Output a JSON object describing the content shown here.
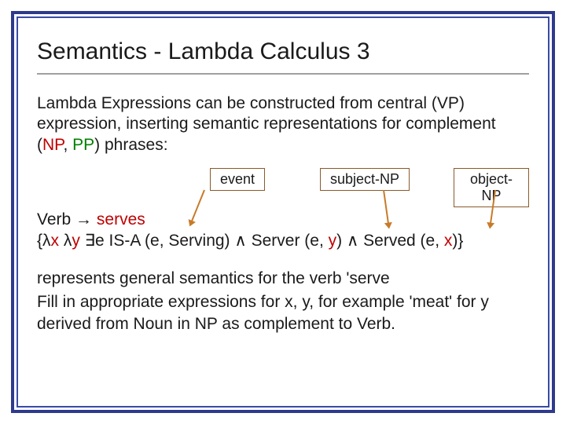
{
  "title": "Semantics - Lambda Calculus 3",
  "intro": {
    "pre": "Lambda Expressions can be constructed from central (",
    "vp": "VP",
    "mid1": ") expression, inserting semantic representations for complement (",
    "np": "NP",
    "comma": ", ",
    "pp": "PP",
    "post": ") phrases:"
  },
  "labels": {
    "event": "event",
    "subject": "subject-NP",
    "object": "object-NP"
  },
  "verbline": {
    "verb": "Verb ",
    "arrow": "→ ",
    "serves": "serves"
  },
  "formula": {
    "open": " {",
    "l1": "λ",
    "x1": "x ",
    "l2": "λ",
    "y1": "y  ",
    "exist": "∃",
    "e1": "e IS-A (e, Serving) ",
    "and1": "∧",
    "srv": " Server (e, ",
    "y2": "y",
    "mid2": ") ",
    "and2": "∧",
    "svd": " Served (e, ",
    "x2": "x",
    "close": ")}"
  },
  "explain1": "represents general semantics for the verb 'serve",
  "explain2": "Fill in appropriate expressions for x, y, for example 'meat' for y derived from Noun in NP as complement to Verb."
}
